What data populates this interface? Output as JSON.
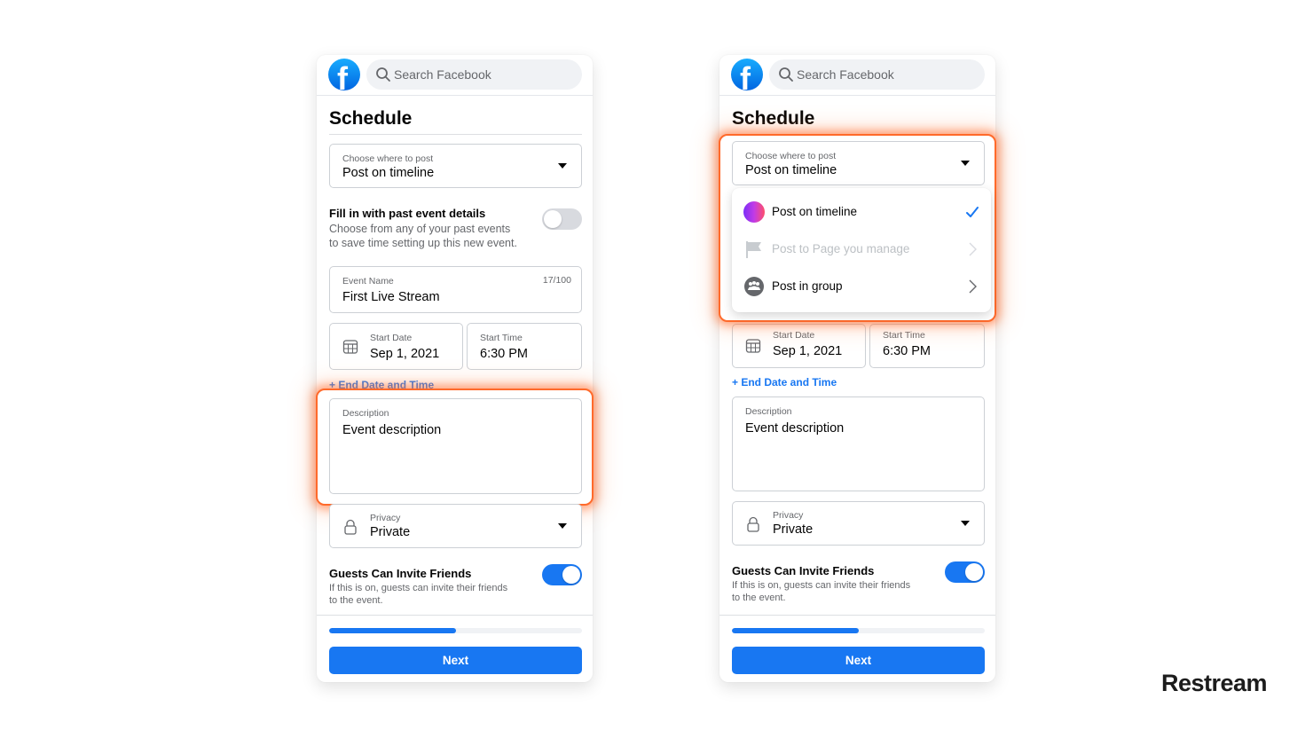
{
  "brand": "Restream",
  "colors": {
    "accent": "#1877f2",
    "highlight": "#ff6a2b",
    "toggle_off": "#d8dadf"
  },
  "screens": [
    {
      "header": {
        "logo_icon": "facebook-logo-icon",
        "search_placeholder": "Search Facebook"
      },
      "title": "Schedule",
      "post_where": {
        "label": "Choose where to post",
        "value": "Post on timeline"
      },
      "past_event": {
        "title": "Fill in with past event details",
        "subtitle_line1": "Choose from any of your past events",
        "subtitle_line2": "to save time setting up this new event.",
        "toggle_on": false
      },
      "event_name": {
        "label": "Event Name",
        "value": "First Live Stream",
        "counter": "17/100"
      },
      "start_date": {
        "label": "Start Date",
        "value": "Sep 1, 2021"
      },
      "start_time": {
        "label": "Start Time",
        "value": "6:30 PM"
      },
      "end_date_link": "+ End Date and Time",
      "description": {
        "label": "Description",
        "value": "Event description"
      },
      "privacy": {
        "label": "Privacy",
        "value": "Private"
      },
      "guests": {
        "title": "Guests Can Invite Friends",
        "subtitle_line1": "If this is on, guests can invite their friends",
        "subtitle_line2": "to the event.",
        "toggle_on": true
      },
      "progress_percent": 50,
      "next_label": "Next",
      "highlighted": "description"
    },
    {
      "header": {
        "logo_icon": "facebook-logo-icon",
        "search_placeholder": "Search Facebook"
      },
      "title": "Schedule",
      "post_where": {
        "label": "Choose where to post",
        "value": "Post on timeline"
      },
      "dropdown_open": true,
      "dropdown_options": [
        {
          "label": "Post on timeline",
          "icon": "profile-gradient-icon",
          "selected": true,
          "disabled": false,
          "right_icon": "checkmark-icon"
        },
        {
          "label": "Post to Page you manage",
          "icon": "flag-icon",
          "selected": false,
          "disabled": true,
          "right_icon": "chevron-right-icon"
        },
        {
          "label": "Post in group",
          "icon": "group-icon",
          "selected": false,
          "disabled": false,
          "right_icon": "chevron-right-icon"
        }
      ],
      "start_date": {
        "label": "Start Date",
        "value": "Sep 1, 2021"
      },
      "start_time": {
        "label": "Start Time",
        "value": "6:30 PM"
      },
      "end_date_link": "+ End Date and Time",
      "description": {
        "label": "Description",
        "value": "Event description"
      },
      "privacy": {
        "label": "Privacy",
        "value": "Private"
      },
      "guests": {
        "title": "Guests Can Invite Friends",
        "subtitle_line1": "If this is on, guests can invite their friends",
        "subtitle_line2": "to the event.",
        "toggle_on": true
      },
      "progress_percent": 50,
      "next_label": "Next",
      "highlighted": "post_where"
    }
  ]
}
